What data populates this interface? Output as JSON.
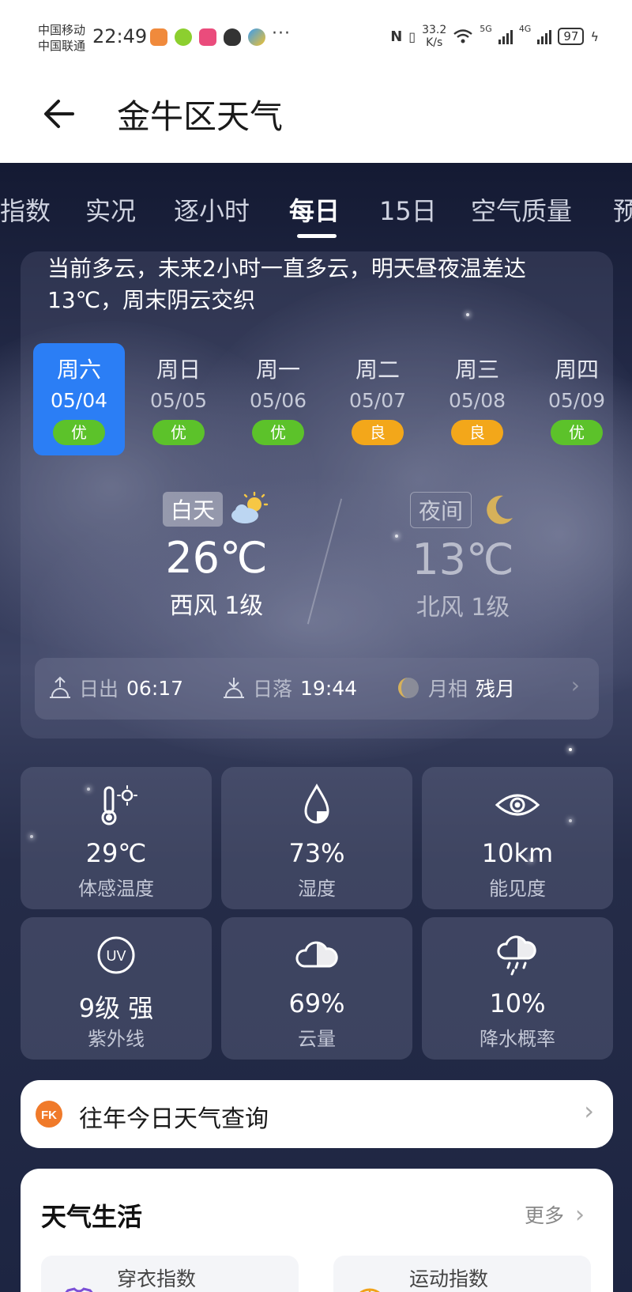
{
  "status_bar": {
    "carrier_1": "中国移动",
    "carrier_2": "中国联通",
    "time": "22:49",
    "net_speed_value": "33.2",
    "net_speed_unit": "K/s",
    "net_1": "5G",
    "net_2": "4G",
    "battery": "97"
  },
  "header": {
    "title": "金牛区天气"
  },
  "tabs": [
    {
      "label": "指数"
    },
    {
      "label": "实况"
    },
    {
      "label": "逐小时"
    },
    {
      "label": "每日",
      "active": true
    },
    {
      "label": "15日"
    },
    {
      "label": "空气质量"
    },
    {
      "label": "预"
    }
  ],
  "summary": "当前多云，未来2小时一直多云，明天昼夜温差达13℃，周末阴云交织",
  "days": [
    {
      "name": "周六",
      "date": "05/04",
      "aqi": "优",
      "level": "good",
      "selected": true
    },
    {
      "name": "周日",
      "date": "05/05",
      "aqi": "优",
      "level": "good"
    },
    {
      "name": "周一",
      "date": "05/06",
      "aqi": "优",
      "level": "good"
    },
    {
      "name": "周二",
      "date": "05/07",
      "aqi": "良",
      "level": "mod"
    },
    {
      "name": "周三",
      "date": "05/08",
      "aqi": "良",
      "level": "mod"
    },
    {
      "name": "周四",
      "date": "05/09",
      "aqi": "优",
      "level": "good"
    }
  ],
  "daytime": {
    "label": "白天",
    "temp": "26℃",
    "wind": "西风 1级",
    "icon": "partly-cloudy-icon"
  },
  "night": {
    "label": "夜间",
    "temp": "13℃",
    "wind": "北风 1级",
    "icon": "moon-icon"
  },
  "sun_moon": {
    "sunrise_label": "日出",
    "sunrise": "06:17",
    "sunset_label": "日落",
    "sunset": "19:44",
    "moon_label": "月相",
    "moon_phase": "残月"
  },
  "metrics": [
    {
      "value": "29℃",
      "label": "体感温度",
      "icon": "thermometer-icon"
    },
    {
      "value": "73%",
      "label": "湿度",
      "icon": "humidity-drop-icon"
    },
    {
      "value": "10km",
      "label": "能见度",
      "icon": "eye-icon"
    },
    {
      "value": "9级  强",
      "label": "紫外线",
      "icon": "uv-icon"
    },
    {
      "value": "69%",
      "label": "云量",
      "icon": "cloud-icon"
    },
    {
      "value": "10%",
      "label": "降水概率",
      "icon": "rain-cloud-icon"
    }
  ],
  "history": {
    "label": "往年今日天气查询",
    "logo_text": "FK"
  },
  "life": {
    "title": "天气生活",
    "more": "更多",
    "items": [
      {
        "name": "穿衣指数"
      },
      {
        "name": "运动指数"
      }
    ]
  },
  "colors": {
    "accent_blue": "#2b7ef5",
    "aqi_good": "#5cc22a",
    "aqi_moderate": "#f3a71a"
  }
}
